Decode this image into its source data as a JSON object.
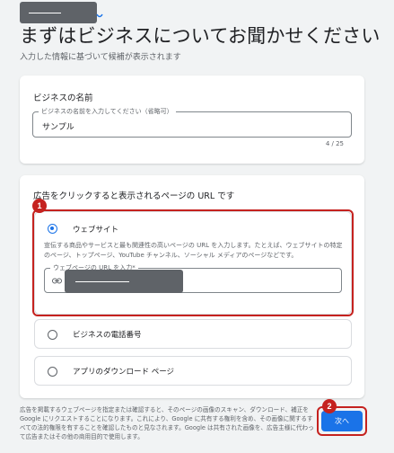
{
  "page": {
    "heading": "まずはビジネスについてお聞かせください",
    "subheading": "入力した情報に基づいて候補が表示されます"
  },
  "business_name_card": {
    "title": "ビジネスの名前",
    "field_label": "ビジネスの名前を入力してください（省略可）",
    "field_value": "サンプル",
    "counter": "4 / 25"
  },
  "destination_card": {
    "title": "広告をクリックすると表示されるページの URL です",
    "options": [
      {
        "label": "ウェブサイト",
        "selected": true,
        "description": "宣伝する商品やサービスと最も関連性の高いページの URL を入力します。たとえば、ウェブサイトの特定のページ、トップページ、YouTube チャンネル、ソーシャル メディアのページなどです。",
        "url_field_label": "ウェブページの URL を入力*",
        "url_icon": "link-icon"
      },
      {
        "label": "ビジネスの電話番号",
        "selected": false
      },
      {
        "label": "アプリのダウンロード ページ",
        "selected": false
      }
    ]
  },
  "footer": {
    "text": "広告を掲載するウェブページを指定または確認すると、そのページの画像のスキャン、ダウンロード、補正を Google にリクエストすることになります。これにより、Google に共有する権利を含め、その画像に関するすべての法的権限を有することを確認したものと見なされます。Google は共有された画像を、広告主様に代わって広告またはその他の商用目的で使用します。",
    "next_label": "次へ"
  },
  "annotations": {
    "marker_1": "1",
    "marker_2": "2",
    "color": "#c5221f"
  },
  "colors": {
    "accent": "#1a73e8",
    "background": "#f1f3f4",
    "redaction": "#5f6368"
  }
}
